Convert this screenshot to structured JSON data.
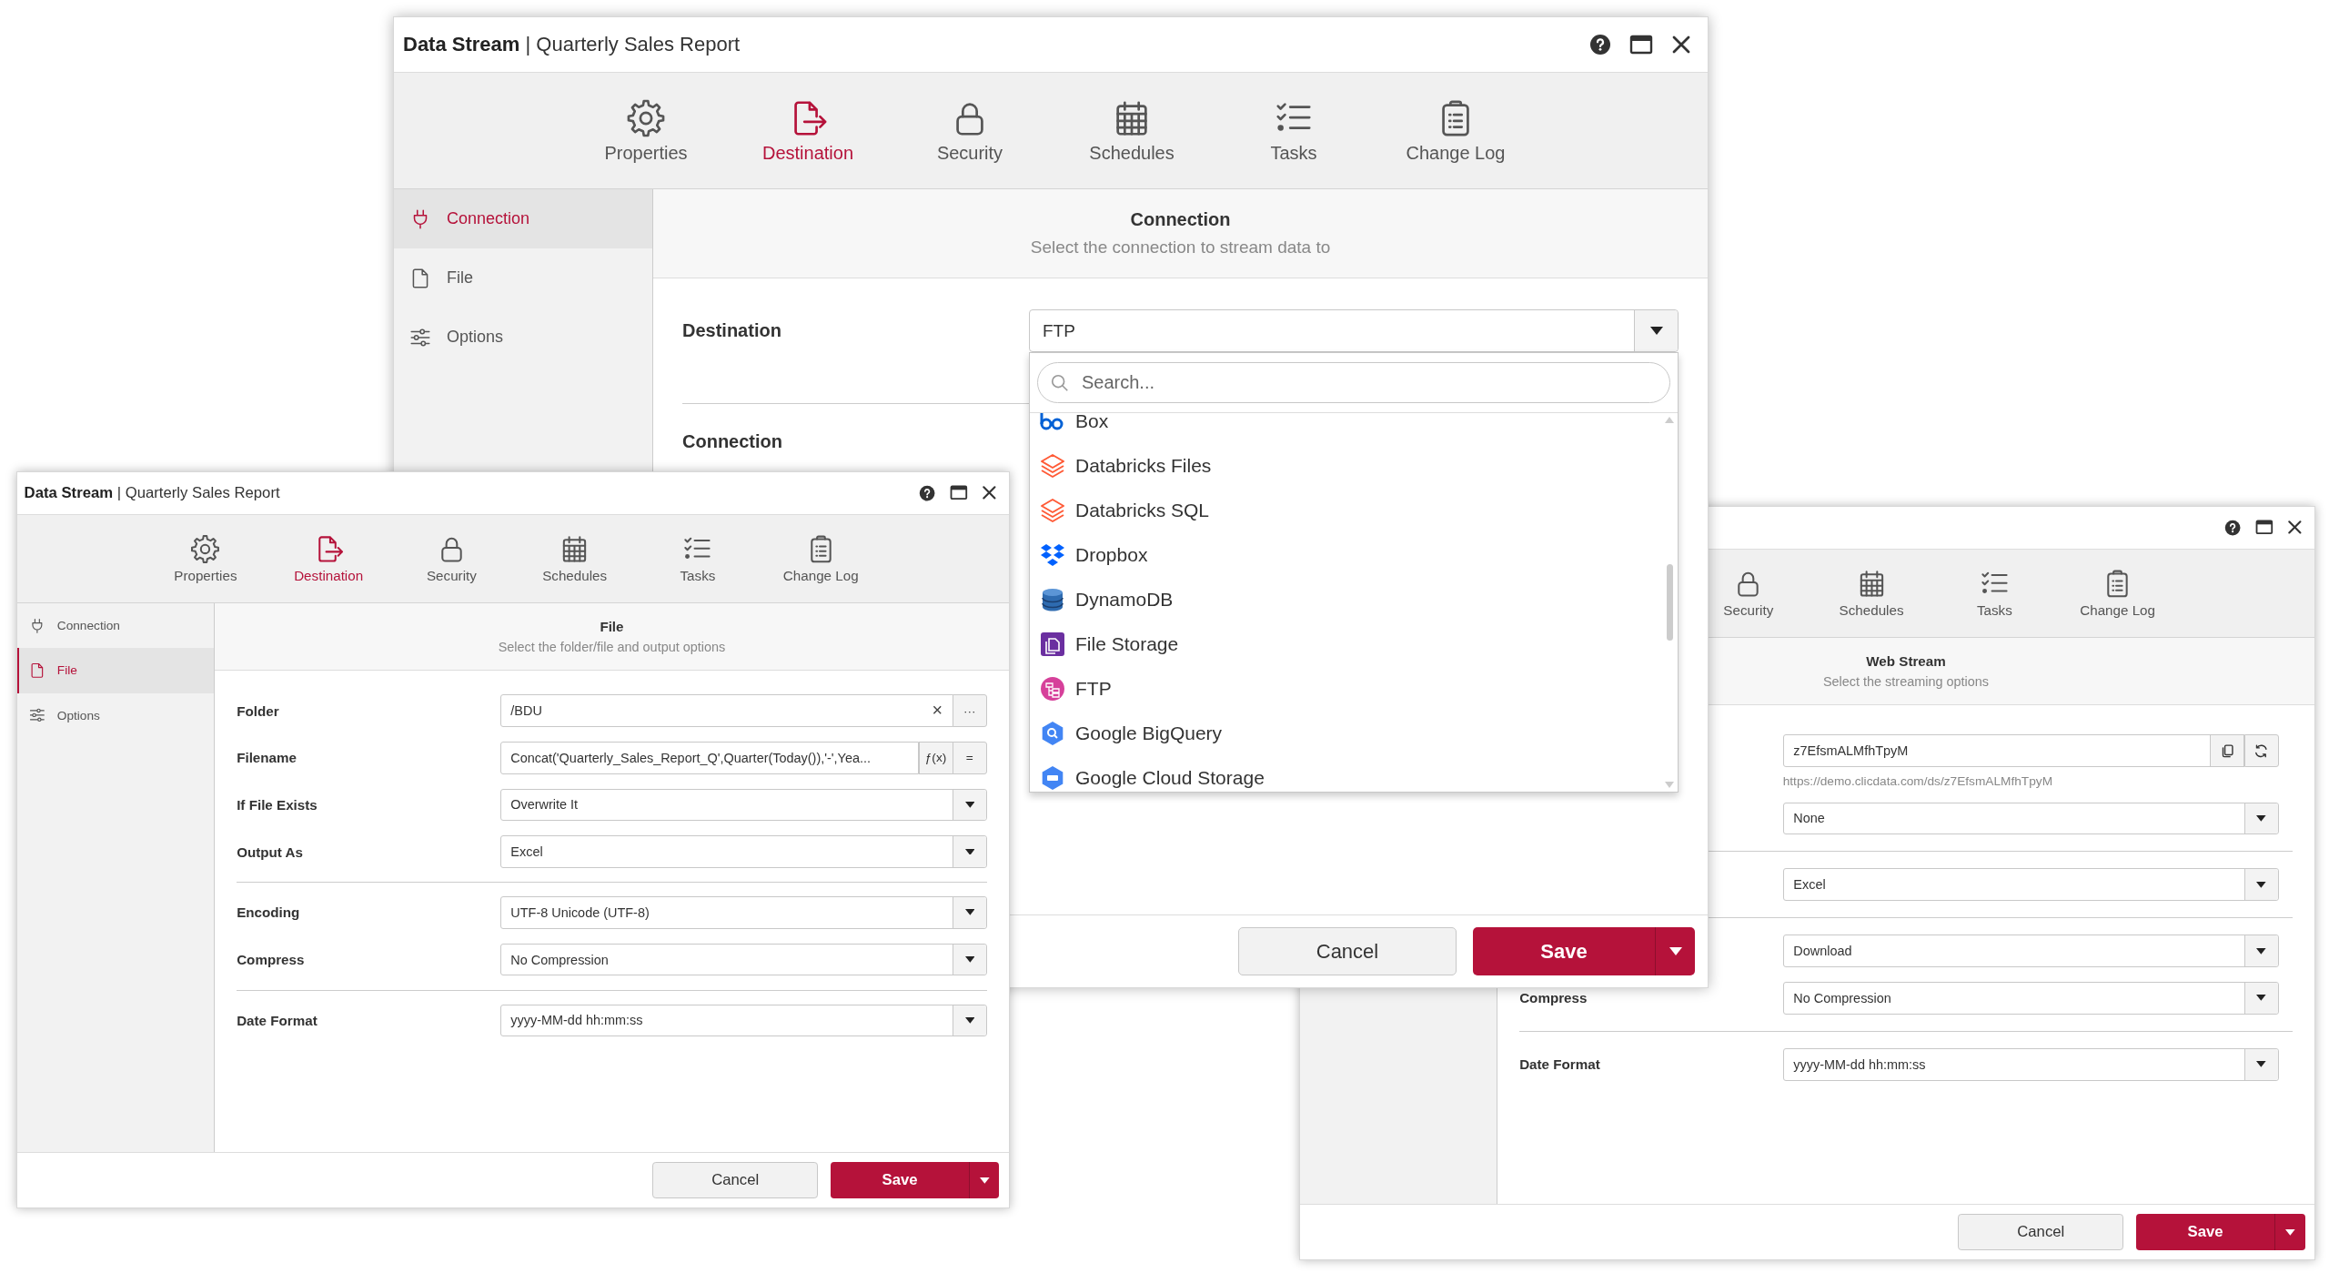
{
  "windows": [
    {
      "title": "**Data Stream** | Quarterly Sales Report",
      "tabs": [
        {
          "label": "Properties",
          "kind": "gear",
          "selected": false
        },
        {
          "label": "Destination",
          "kind": "export",
          "selected": true
        },
        {
          "label": "Security",
          "kind": "lock",
          "selected": false
        },
        {
          "label": "Schedules",
          "kind": "calendar",
          "selected": false
        },
        {
          "label": "Tasks",
          "kind": "checklist",
          "selected": false
        },
        {
          "label": "Change Log",
          "kind": "clipboard",
          "selected": false
        }
      ],
      "sidebar": {
        "items": [
          {
            "label": "Connection",
            "kind": "plug",
            "selected": true
          },
          {
            "label": "File",
            "kind": "file",
            "selected": false
          },
          {
            "label": "Options",
            "kind": "sliders",
            "selected": false
          }
        ]
      },
      "section": {
        "title": "Connection",
        "subtitle": "Select the connection to stream data to"
      },
      "groups": [
        [
          {
            "label": "Destination",
            "kind": "select",
            "value": "FTP",
            "expanded": true,
            "dropdown": {
              "search": {
                "placeholder": "Search..."
              },
              "items": [
                {
                  "label": "Box",
                  "kind": "box"
                },
                {
                  "label": "Databricks Files",
                  "kind": "layers"
                },
                {
                  "label": "Databricks SQL",
                  "kind": "layers"
                },
                {
                  "label": "Dropbox",
                  "kind": "diamonds"
                },
                {
                  "label": "DynamoDB",
                  "kind": "database"
                },
                {
                  "label": "File Storage",
                  "kind": "files"
                },
                {
                  "label": "FTP",
                  "kind": "ftp"
                },
                {
                  "label": "Google BigQuery",
                  "kind": "hex-search"
                },
                {
                  "label": "Google Cloud Storage",
                  "kind": "hex-storage"
                }
              ]
            }
          }
        ],
        [
          {
            "label": "Connection",
            "kind": "label"
          }
        ]
      ],
      "buttons": {
        "cancel": "Cancel",
        "save": "Save"
      }
    },
    {
      "title": "**Data Stream** | Quarterly Sales Report",
      "tabs": [
        {
          "label": "Properties",
          "kind": "gear",
          "selected": false
        },
        {
          "label": "Destination",
          "kind": "export",
          "selected": true
        },
        {
          "label": "Security",
          "kind": "lock",
          "selected": false
        },
        {
          "label": "Schedules",
          "kind": "calendar",
          "selected": false
        },
        {
          "label": "Tasks",
          "kind": "checklist",
          "selected": false
        },
        {
          "label": "Change Log",
          "kind": "clipboard",
          "selected": false
        }
      ],
      "sidebar": {
        "items": [
          {
            "label": "Connection",
            "kind": "plug",
            "selected": false
          },
          {
            "label": "File",
            "kind": "file",
            "selected": true
          },
          {
            "label": "Options",
            "kind": "sliders",
            "selected": false
          }
        ]
      },
      "section": {
        "title": "File",
        "subtitle": "Select the folder/file and output options"
      },
      "groups": [
        [
          {
            "label": "Folder",
            "kind": "input",
            "value": "/BDU",
            "actions": [
              {
                "kind": "clear",
                "label": "×"
              },
              {
                "kind": "button",
                "label": "···"
              }
            ]
          },
          {
            "label": "Filename",
            "kind": "input",
            "value": "Concat('Quarterly_Sales_Report_Q',Quarter(Today()),'-',Yea...",
            "actions": [
              {
                "kind": "button",
                "label": "ƒ(x)"
              },
              {
                "kind": "button",
                "label": "="
              }
            ]
          },
          {
            "label": "If File Exists",
            "kind": "select",
            "value": "Overwrite It"
          },
          {
            "label": "Output As",
            "kind": "select",
            "value": "Excel"
          }
        ],
        [
          {
            "label": "Encoding",
            "kind": "select",
            "value": "UTF-8 Unicode (UTF-8)"
          },
          {
            "label": "Compress",
            "kind": "select",
            "value": "No Compression"
          }
        ],
        [
          {
            "label": "Date Format",
            "kind": "select",
            "value": "yyyy-MM-dd hh:mm:ss"
          }
        ]
      ],
      "buttons": {
        "cancel": "Cancel",
        "save": "Save"
      }
    },
    {
      "tabs": [
        {
          "label": "Security",
          "kind": "lock",
          "selected": false
        },
        {
          "label": "Schedules",
          "kind": "calendar",
          "selected": false
        },
        {
          "label": "Tasks",
          "kind": "checklist",
          "selected": false
        },
        {
          "label": "Change Log",
          "kind": "clipboard",
          "selected": false
        }
      ],
      "section": {
        "title": "Web Stream",
        "subtitle": "Select the streaming options"
      },
      "groups": [
        [
          {
            "kind": "input",
            "value": "z7EfsmALMfhTpyM",
            "actions": [
              {
                "kind": "copy"
              },
              {
                "kind": "refresh"
              }
            ],
            "note": "https://demo.clicdata.com/ds/z7EfsmALMfhTpyM"
          },
          {
            "kind": "select",
            "value": "None"
          }
        ],
        [
          {
            "kind": "select",
            "value": "Excel"
          }
        ],
        [
          {
            "kind": "select",
            "value": "Download"
          },
          {
            "label": "Compress",
            "kind": "select",
            "value": "No Compression"
          }
        ],
        [
          {
            "label": "Date Format",
            "kind": "select",
            "value": "yyyy-MM-dd hh:mm:ss"
          }
        ]
      ],
      "buttons": {
        "cancel": "Cancel",
        "save": "Save"
      }
    }
  ]
}
